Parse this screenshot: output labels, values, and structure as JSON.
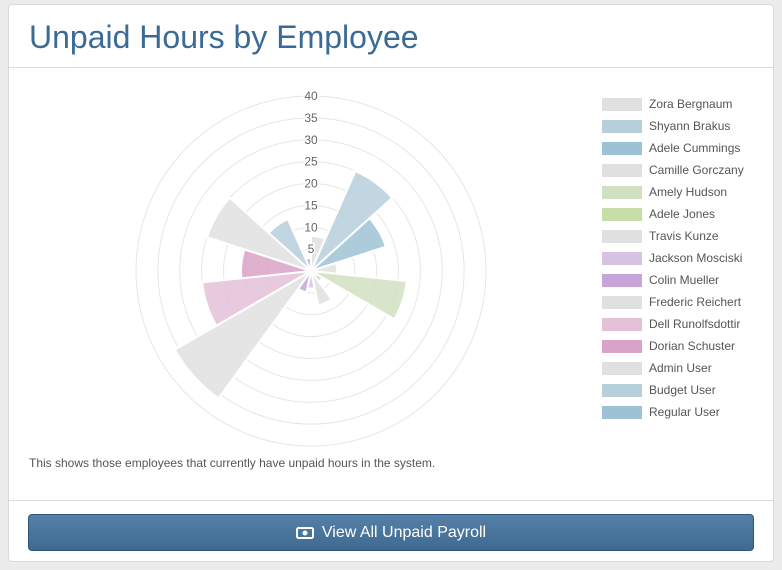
{
  "header": {
    "title": "Unpaid Hours by Employee"
  },
  "description": "This shows those employees that currently have unpaid hours in the system.",
  "footer": {
    "button_label": "View All Unpaid Payroll",
    "button_icon": "money-icon"
  },
  "chart_data": {
    "type": "polarArea",
    "title": "",
    "scale": {
      "min": 0,
      "max": 40,
      "step": 5,
      "ticks": [
        "5",
        "10",
        "15",
        "20",
        "25",
        "30",
        "35",
        "40"
      ]
    },
    "grid": true,
    "legend_position": "right",
    "series": [
      {
        "name": "Zora Bergnaum",
        "value": 8,
        "color": "#e0e0e0"
      },
      {
        "name": "Shyann Brakus",
        "value": 25,
        "color": "#b7cfdc"
      },
      {
        "name": "Adele Cummings",
        "value": 18,
        "color": "#9ec2d5"
      },
      {
        "name": "Camille Gorczany",
        "value": 6,
        "color": "#e0e0e0"
      },
      {
        "name": "Amely Hudson",
        "value": 22,
        "color": "#d2e0c2"
      },
      {
        "name": "Adele Jones",
        "value": 3,
        "color": "#c7dea8"
      },
      {
        "name": "Travis Kunze",
        "value": 8,
        "color": "#e0e0e0"
      },
      {
        "name": "Jackson Mosciski",
        "value": 4,
        "color": "#d7c2e4"
      },
      {
        "name": "Colin Mueller",
        "value": 5,
        "color": "#c7a5d8"
      },
      {
        "name": "Frederic Reichert",
        "value": 36,
        "color": "#e0e0e0"
      },
      {
        "name": "Dell Runolfsdottir",
        "value": 25,
        "color": "#e4c1d8"
      },
      {
        "name": "Dorian Schuster",
        "value": 16,
        "color": "#d9a3c7"
      },
      {
        "name": "Admin User",
        "value": 25,
        "color": "#e0e0e0"
      },
      {
        "name": "Budget User",
        "value": 13,
        "color": "#b7cfdc"
      },
      {
        "name": "Regular User",
        "value": 3,
        "color": "#9ec2d5"
      }
    ]
  }
}
